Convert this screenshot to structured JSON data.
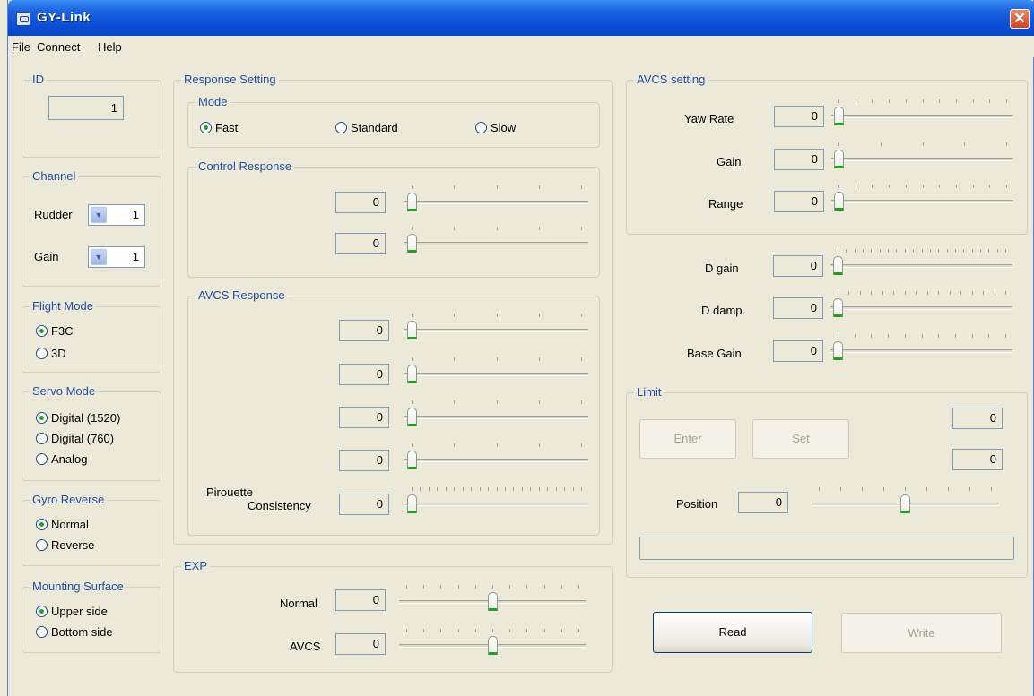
{
  "window": {
    "title": "GY-Link",
    "close_glyph": "✕"
  },
  "menu": {
    "file": "File",
    "connect": "Connect",
    "help": "Help"
  },
  "id_group": {
    "label": "ID",
    "value": "1"
  },
  "channel": {
    "label": "Channel",
    "rudder_label": "Rudder",
    "rudder_value": "1",
    "gain_label": "Gain",
    "gain_value": "1"
  },
  "flight_mode": {
    "label": "Flight Mode",
    "options": [
      "F3C",
      "3D"
    ],
    "selected": "F3C"
  },
  "servo_mode": {
    "label": "Servo Mode",
    "options": [
      "Digital (1520)",
      "Digital (760)",
      "Analog"
    ],
    "selected": "Digital (1520)"
  },
  "gyro_reverse": {
    "label": "Gyro Reverse",
    "options": [
      "Normal",
      "Reverse"
    ],
    "selected": "Normal"
  },
  "mounting_surface": {
    "label": "Mounting Surface",
    "options": [
      "Upper side",
      "Bottom side"
    ],
    "selected": "Upper side"
  },
  "response_setting": {
    "label": "Response Setting",
    "mode": {
      "label": "Mode",
      "options": [
        "Fast",
        "Standard",
        "Slow"
      ],
      "selected": "Fast"
    },
    "control_response": {
      "label": "Control Response",
      "values": [
        "0",
        "0"
      ]
    },
    "avcs_response": {
      "label": "AVCS Response",
      "values": [
        "0",
        "0",
        "0",
        "0"
      ]
    },
    "pirouette": {
      "label_line1": "Pirouette",
      "label_line2": "Consistency",
      "value": "0"
    }
  },
  "exp": {
    "label": "EXP",
    "normal_label": "Normal",
    "normal_value": "0",
    "avcs_label": "AVCS",
    "avcs_value": "0"
  },
  "avcs_setting": {
    "label": "AVCS setting",
    "yaw_rate_label": "Yaw Rate",
    "yaw_rate_value": "0",
    "gain_label": "Gain",
    "gain_value": "0",
    "range_label": "Range",
    "range_value": "0"
  },
  "d_params": {
    "d_gain_label": "D gain",
    "d_gain_value": "0",
    "d_damp_label": "D damp.",
    "d_damp_value": "0",
    "base_gain_label": "Base Gain",
    "base_gain_value": "0"
  },
  "limit": {
    "label": "Limit",
    "enter_label": "Enter",
    "set_label": "Set",
    "value_top": "0",
    "value_bottom": "0",
    "position_label": "Position",
    "position_value": "0"
  },
  "actions": {
    "read_label": "Read",
    "write_label": "Write"
  }
}
